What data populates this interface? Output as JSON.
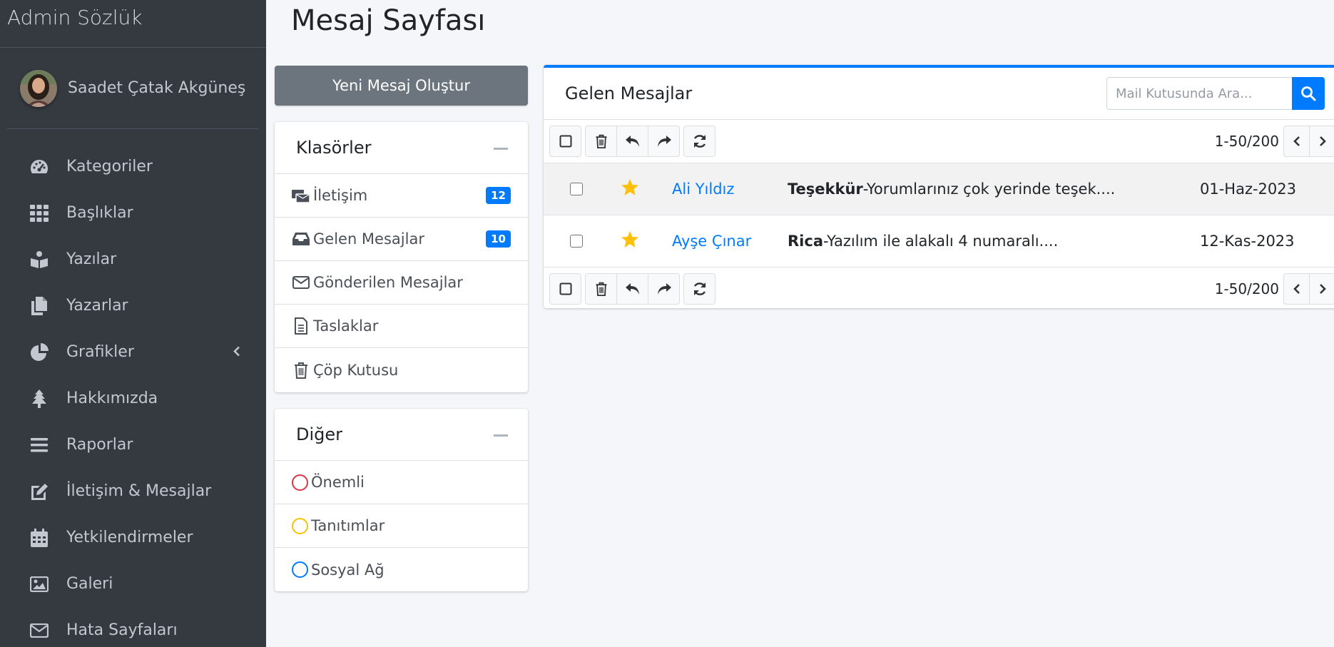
{
  "sidebar": {
    "brand": "Admin Sözlük",
    "user_name": "Saadet Çatak Akgüneş",
    "items": [
      {
        "label": "Kategoriler",
        "icon": "tachometer-icon"
      },
      {
        "label": "Başlıklar",
        "icon": "grid-icon"
      },
      {
        "label": "Yazılar",
        "icon": "book-reader-icon"
      },
      {
        "label": "Yazarlar",
        "icon": "copy-icon"
      },
      {
        "label": "Grafikler",
        "icon": "pie-chart-icon"
      },
      {
        "label": "Hakkımızda",
        "icon": "tree-icon"
      },
      {
        "label": "Raporlar",
        "icon": "bars-icon"
      },
      {
        "label": "İletişim & Mesajlar",
        "icon": "edit-icon"
      },
      {
        "label": "Yetkilendirmeler",
        "icon": "calendar-icon"
      },
      {
        "label": "Galeri",
        "icon": "image-icon"
      },
      {
        "label": "Hata Sayfaları",
        "icon": "envelope-icon"
      }
    ]
  },
  "page": {
    "title": "Mesaj Sayfası"
  },
  "compose_button": "Yeni Mesaj Oluştur",
  "folders": {
    "title": "Klasörler",
    "items": [
      {
        "label": "İletişim",
        "icon": "envelopes-icon",
        "badge": "12"
      },
      {
        "label": "Gelen Mesajlar",
        "icon": "inbox-icon",
        "badge": "10"
      },
      {
        "label": "Gönderilen Mesajlar",
        "icon": "envelope-icon"
      },
      {
        "label": "Taslaklar",
        "icon": "file-icon"
      },
      {
        "label": "Çöp Kutusu",
        "icon": "trash-icon"
      }
    ]
  },
  "other": {
    "title": "Diğer",
    "items": [
      {
        "label": "Önemli",
        "color": "#dc3545"
      },
      {
        "label": "Tanıtımlar",
        "color": "#ffc107"
      },
      {
        "label": "Sosyal Ağ",
        "color": "#007bff"
      }
    ]
  },
  "mailbox": {
    "title": "Gelen Mesajlar",
    "search_placeholder": "Mail Kutusunda Ara...",
    "pagination": "1-50/200",
    "messages": [
      {
        "sender": "Ali Yıldız",
        "subject": "Teşekkür",
        "preview": "-Yorumlarınız çok yerinde teşek....",
        "date": "01-Haz-2023",
        "starred": true
      },
      {
        "sender": "Ayşe Çınar",
        "subject": "Rica",
        "preview": "-Yazılım ile alakalı 4 numaralı....",
        "date": "12-Kas-2023",
        "starred": true
      }
    ]
  },
  "colors": {
    "sidebar_bg": "#343a40",
    "primary": "#007bff",
    "star": "#ffc107",
    "compose_btn": "#6c757d"
  }
}
